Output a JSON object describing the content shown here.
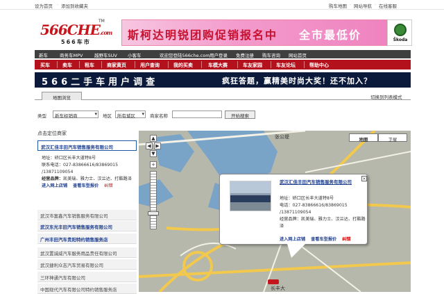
{
  "topbar": {
    "set_home": "设为首页",
    "add_fav": "添加到收藏夹",
    "car_map": "购车地图",
    "site_guide": "网站导航",
    "online_customer": "在线客服"
  },
  "logo": {
    "main": "566CHE",
    "suffix": ".com",
    "sub": "566车市",
    "tm": "TM"
  },
  "banner": {
    "text1": "斯柯达明锐团购促销报名中",
    "text2": "全市最低价",
    "brand": "Škoda",
    "brand_cn": "斯柯达"
  },
  "nav_top": [
    "新车",
    "商务车MPV",
    "越野车SUV",
    "小客车",
    "欢迎您登陆566che.com",
    "用户登录",
    "免费注册",
    "购车咨询",
    "网站首页"
  ],
  "nav_main": [
    "买车",
    "卖车",
    "租车",
    "商家黄页",
    "用户查询",
    "我的买卖",
    "车模大赛",
    "车友家园",
    "车友论坛",
    "帮助中心"
  ],
  "survey": {
    "title": "566二手车用户调查",
    "tagline": "疯狂答题，赢精美时尚大奖！还不加入？"
  },
  "tabs": {
    "map_browse": "地图浏览",
    "switch_list": "切换到列表模式"
  },
  "filters": {
    "type_label": "类型",
    "type_value": "新车经销商",
    "area_label": "地区",
    "area_value": "所有城区",
    "dealer_label": "商家名称",
    "dealer_value": "",
    "search_button": "开始搜索"
  },
  "list": {
    "title": "点击定位商家",
    "selected": {
      "name": "武汉汇佳丰田汽车销售服务有限公司",
      "address_label": "地址：",
      "address": "硚口区长丰大道特8号",
      "phone_label": "联系电话：",
      "phone": "027-83866616/83869015 /13871109054",
      "brand_label": "经营品牌：",
      "brands": "凯美瑞、雅力士、汉兰达、打酷路泽",
      "link_store": "进入网上店铺",
      "link_price": "查看车型报价",
      "link_error": "纠错"
    },
    "others": [
      "武汉市富鑫汽车销售服务有限公司",
      "武汉东光丰田汽车销售服务有限公司",
      "广州丰田汽车贵阳特约销售服务店",
      "武汉置诚威汽车服务用品责任有限公司",
      "武汉捷利众志汽车贸易有限公司",
      "三环神通汽车有限公司",
      "中国现代汽车有限公司特约销售服务店"
    ]
  },
  "map": {
    "type_map": "地图",
    "type_satellite": "卫星",
    "label_zhangeng": "张公堤",
    "label_changfeng": "长丰大",
    "bubble": {
      "title": "武汉汇佳丰田汽车销售服务有限公司",
      "address": "地址：硚口区长丰大道特8号",
      "phone": "电话：027-83866616/83869015 /13871109054",
      "brands": "经营品牌：凯美瑞、雅力士、汉兰达、打酷路泽",
      "link_store": "进入网上店铺",
      "link_price": "查看车型报价",
      "link_error": "纠错"
    }
  },
  "colors": {
    "nav_red": "#b3111b",
    "nav_dark": "#3f3f3f",
    "link_blue": "#1f3f8f",
    "survey_bg": "#0b1a3a"
  }
}
